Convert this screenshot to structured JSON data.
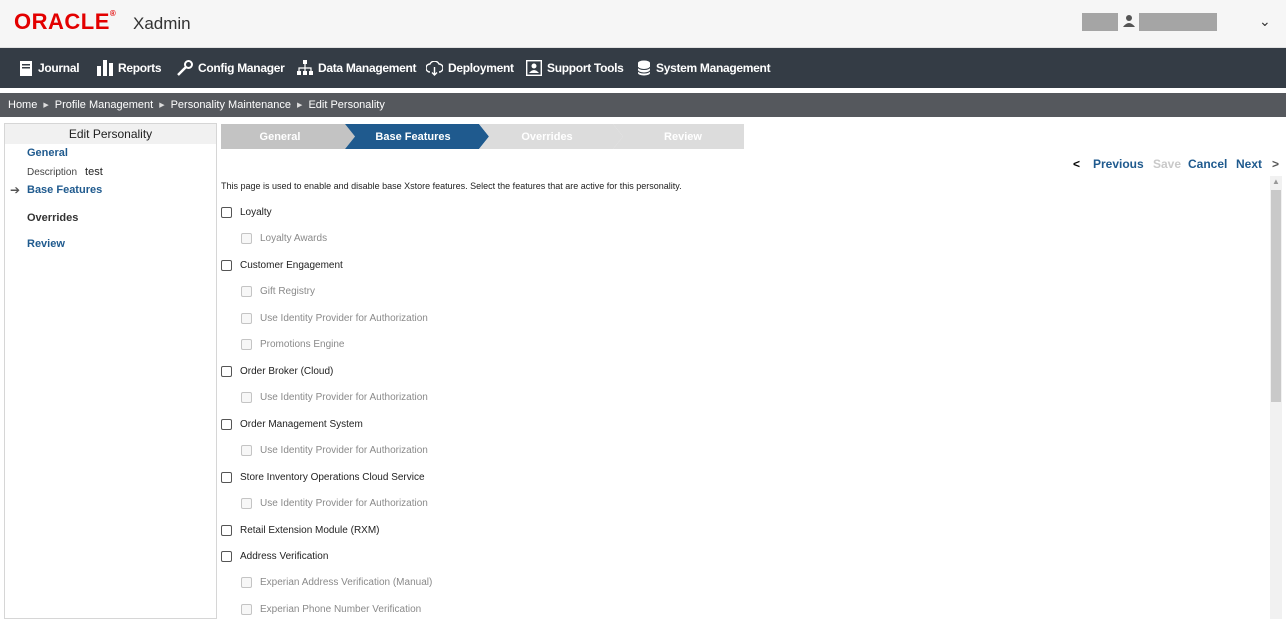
{
  "header": {
    "logo": "ORACLE",
    "app_name": "Xadmin",
    "user_menu_chevron": "⌄"
  },
  "nav": {
    "items": [
      {
        "label": "Journal",
        "icon": "journal-icon"
      },
      {
        "label": "Reports",
        "icon": "reports-icon"
      },
      {
        "label": "Config Manager",
        "icon": "wrench-icon"
      },
      {
        "label": "Data Management",
        "icon": "hierarchy-icon"
      },
      {
        "label": "Deployment",
        "icon": "cloud-download-icon"
      },
      {
        "label": "Support Tools",
        "icon": "support-icon"
      },
      {
        "label": "System Management",
        "icon": "database-icon"
      }
    ]
  },
  "breadcrumb": [
    "Home",
    "Profile Management",
    "Personality Maintenance",
    "Edit Personality"
  ],
  "left_panel": {
    "title": "Edit Personality",
    "general": "General",
    "description_label": "Description",
    "description_value": "test",
    "base_features": "Base Features",
    "overrides": "Overrides",
    "review": "Review"
  },
  "steps": [
    {
      "label": "General",
      "state": "inactive"
    },
    {
      "label": "Base Features",
      "state": "active"
    },
    {
      "label": "Overrides",
      "state": "upcoming"
    },
    {
      "label": "Review",
      "state": "upcoming"
    }
  ],
  "actions": {
    "previous": "Previous",
    "save": "Save",
    "cancel": "Cancel",
    "next": "Next"
  },
  "intro_text": "This page is used to enable and disable base Xstore features. Select the features that are active for this personality.",
  "features": [
    {
      "label": "Loyalty",
      "level": "parent",
      "checked": false
    },
    {
      "label": "Loyalty Awards",
      "level": "child",
      "checked": false
    },
    {
      "label": "Customer Engagement",
      "level": "parent",
      "checked": false
    },
    {
      "label": "Gift Registry",
      "level": "child",
      "checked": false
    },
    {
      "label": "Use Identity Provider for Authorization",
      "level": "child",
      "checked": false
    },
    {
      "label": "Promotions Engine",
      "level": "child",
      "checked": false
    },
    {
      "label": "Order Broker (Cloud)",
      "level": "parent",
      "checked": false
    },
    {
      "label": "Use Identity Provider for Authorization",
      "level": "child",
      "checked": false
    },
    {
      "label": "Order Management System",
      "level": "parent",
      "checked": false
    },
    {
      "label": "Use Identity Provider for Authorization",
      "level": "child",
      "checked": false
    },
    {
      "label": "Store Inventory Operations Cloud Service",
      "level": "parent",
      "checked": false
    },
    {
      "label": "Use Identity Provider for Authorization",
      "level": "child",
      "checked": false
    },
    {
      "label": "Retail Extension Module (RXM)",
      "level": "parent",
      "checked": false
    },
    {
      "label": "Address Verification",
      "level": "parent",
      "checked": false
    },
    {
      "label": "Experian Address Verification (Manual)",
      "level": "child",
      "checked": false
    },
    {
      "label": "Experian Phone Number Verification",
      "level": "child",
      "checked": false
    }
  ],
  "colors": {
    "nav_bg": "#343c45",
    "breadcrumb_bg": "#55585d",
    "step_active": "#1f5a8e",
    "step_inactive": "#c3c3c3",
    "link": "#1f5a8e",
    "logo_red": "#e30000"
  }
}
